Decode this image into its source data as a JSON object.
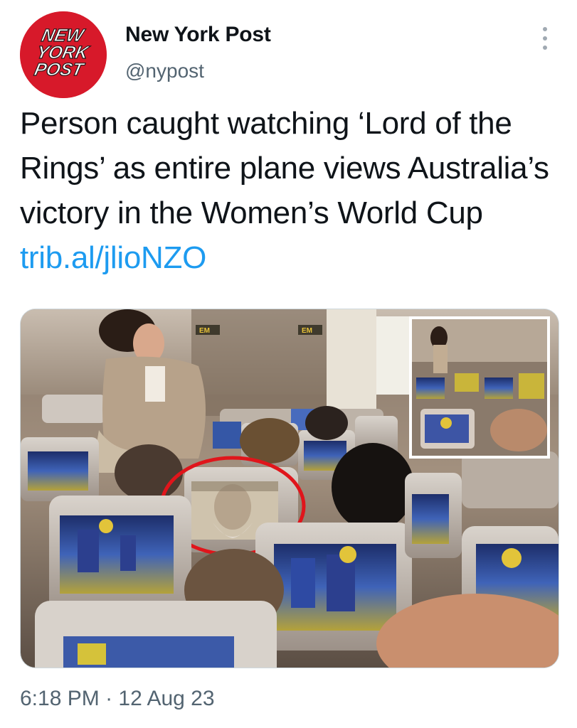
{
  "account": {
    "display_name": "New York Post",
    "handle": "@nypost",
    "logo_lines": [
      "NEW",
      "YORK",
      "POST"
    ],
    "brand_color": "#d7192a"
  },
  "tweet": {
    "text": "Person caught watching ‘Lord of the Rings’ as entire plane views Australia’s victory in the Women’s World Cup",
    "link": "trib.al/jlioNZO",
    "link_color": "#1d9bf0"
  },
  "media": {
    "screen_labels": [
      "EM",
      "EM"
    ],
    "highlight_color": "#e0151b"
  },
  "footer": {
    "time": "6:18 PM",
    "separator": "·",
    "date": "12 Aug 23"
  },
  "icons": {
    "more": "more-vertical-icon"
  }
}
